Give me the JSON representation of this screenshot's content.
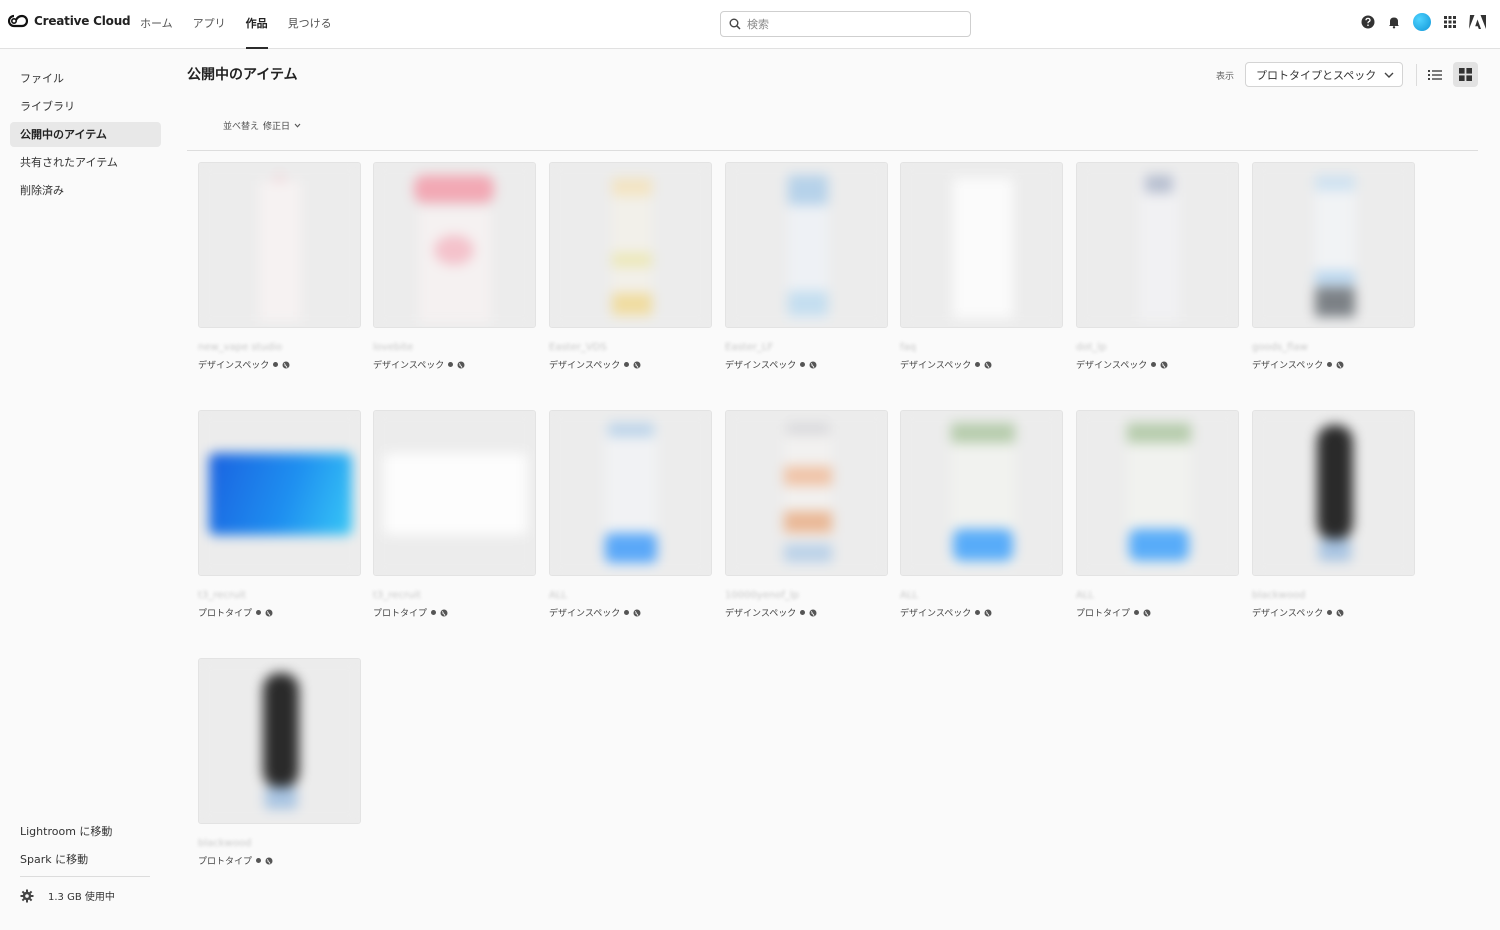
{
  "app": {
    "brand": "Creative Cloud",
    "nav": [
      {
        "label": "ホーム"
      },
      {
        "label": "アプリ"
      },
      {
        "label": "作品"
      },
      {
        "label": "見つける"
      }
    ],
    "search_placeholder": "検索"
  },
  "sidebar": {
    "items": [
      {
        "label": "ファイル"
      },
      {
        "label": "ライブラリ"
      },
      {
        "label": "公開中のアイテム"
      },
      {
        "label": "共有されたアイテム"
      },
      {
        "label": "削除済み"
      }
    ],
    "links": [
      {
        "label": "Lightroom に移動"
      },
      {
        "label": "Spark に移動"
      }
    ],
    "storage": "1.3 GB 使用中"
  },
  "main": {
    "title": "公開中のアイテム",
    "view_label": "表示",
    "view_selected": "プロトタイプとスペック",
    "sort_label": "並べ替え",
    "sort_value": "修正日"
  },
  "cards": [
    {
      "name": "new_vape studio",
      "type": "デザインスペック"
    },
    {
      "name": "lovebite",
      "type": "デザインスペック"
    },
    {
      "name": "Easter_VDS",
      "type": "デザインスペック"
    },
    {
      "name": "Easter_LF",
      "type": "デザインスペック"
    },
    {
      "name": "faq",
      "type": "デザインスペック"
    },
    {
      "name": "dot_lp",
      "type": "デザインスペック"
    },
    {
      "name": "goods_flaw",
      "type": "デザインスペック"
    },
    {
      "name": "t3_recruit",
      "type": "プロトタイプ"
    },
    {
      "name": "t3_recruit",
      "type": "プロトタイプ"
    },
    {
      "name": "ALL",
      "type": "デザインスペック"
    },
    {
      "name": "10000yenof_lp",
      "type": "デザインスペック"
    },
    {
      "name": "ALL",
      "type": "デザインスペック"
    },
    {
      "name": "ALL",
      "type": "プロトタイプ"
    },
    {
      "name": "blackwood",
      "type": "デザインスペック"
    },
    {
      "name": "blackwood",
      "type": "プロトタイプ"
    }
  ],
  "icons": {
    "logo": "creative-cloud-logo-icon",
    "help": "help-icon",
    "bell": "bell-icon",
    "apps": "apps-grid-icon",
    "adobe": "adobe-logo-icon",
    "gear": "gear-icon",
    "globe": "globe-icon"
  }
}
